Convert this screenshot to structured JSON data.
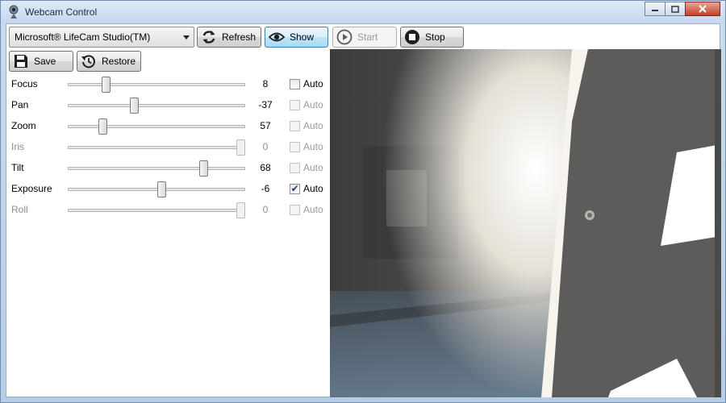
{
  "window": {
    "title": "Webcam Control"
  },
  "toolbar": {
    "camera": "Microsoft® LifeCam Studio(TM)",
    "refresh": "Refresh",
    "show": "Show",
    "start": "Start",
    "stop": "Stop",
    "save": "Save",
    "restore": "Restore"
  },
  "controls": [
    {
      "label": "Focus",
      "value": "8",
      "level": 0.2,
      "auto": false,
      "enabled": true,
      "auto_enabled": true,
      "auto_label": "Auto"
    },
    {
      "label": "Pan",
      "value": "-37",
      "level": 0.37,
      "auto": false,
      "enabled": true,
      "auto_enabled": false,
      "auto_label": "Auto"
    },
    {
      "label": "Zoom",
      "value": "57",
      "level": 0.18,
      "auto": false,
      "enabled": true,
      "auto_enabled": false,
      "auto_label": "Auto"
    },
    {
      "label": "Iris",
      "value": "0",
      "level": 1.0,
      "auto": false,
      "enabled": false,
      "auto_enabled": false,
      "auto_label": "Auto"
    },
    {
      "label": "Tilt",
      "value": "68",
      "level": 0.78,
      "auto": false,
      "enabled": true,
      "auto_enabled": false,
      "auto_label": "Auto"
    },
    {
      "label": "Exposure",
      "value": "-6",
      "level": 0.53,
      "auto": true,
      "enabled": true,
      "auto_enabled": true,
      "auto_label": "Auto"
    },
    {
      "label": "Roll",
      "value": "0",
      "level": 1.0,
      "auto": false,
      "enabled": false,
      "auto_enabled": false,
      "auto_label": "Auto"
    }
  ],
  "icons": {
    "app": "webcam-icon",
    "refresh": "refresh-icon",
    "show": "eye-icon",
    "start": "play-icon",
    "stop": "stop-icon",
    "save": "floppy-disk-icon",
    "restore": "restore-icon"
  },
  "colors": {
    "active_button": "#bee6fd",
    "check": "#243d7a"
  }
}
